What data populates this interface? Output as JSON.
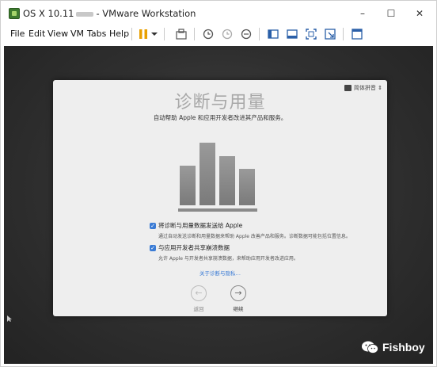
{
  "window": {
    "title_prefix": "OS X 10.11",
    "title_suffix": "- VMware Workstation",
    "minimize": "–",
    "maximize": "☐",
    "close": "✕"
  },
  "menu": {
    "file": "File",
    "edit": "Edit",
    "view": "View",
    "vm": "VM",
    "tabs": "Tabs",
    "help": "Help"
  },
  "colors": {
    "accent": "#3a7bd5",
    "pause": "#e8a000",
    "vm_bg": "#2f2f2f"
  },
  "dialog": {
    "language": "简体拼音",
    "title": "诊断与用量",
    "subtitle": "自动帮助 Apple 和应用开发者改进其产品和服务。",
    "option1_label": "将诊断与用量数据发送给 Apple",
    "option1_desc": "通过自动发送诊断和用量数据来帮助 Apple 改善产品和服务。诊断数据可能包括位置信息。",
    "option1_checked": true,
    "option2_label": "与应用开发者共享崩溃数据",
    "option2_desc": "允许 Apple 与开发者共享崩溃数据，来帮助应用开发者改进应用。",
    "option2_checked": true,
    "about_link": "关于诊断与隐私…",
    "back_label": "返回",
    "continue_label": "继续"
  },
  "watermark": {
    "text": "Fishboy"
  }
}
